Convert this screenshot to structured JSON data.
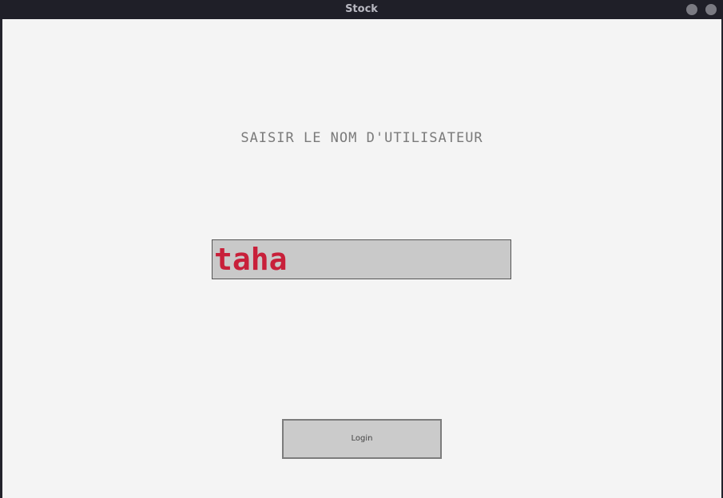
{
  "window": {
    "title": "Stock",
    "controls": [
      "minimize-icon",
      "close-icon"
    ]
  },
  "form": {
    "prompt": "SAISIR LE NOM D'UTILISATEUR",
    "username_value": "taha",
    "login_label": "Login"
  },
  "colors": {
    "input_text": "#c8203a",
    "input_bg": "#c9c9c9",
    "window_bg": "#f4f4f4",
    "titlebar_bg": "#1f1f28"
  }
}
